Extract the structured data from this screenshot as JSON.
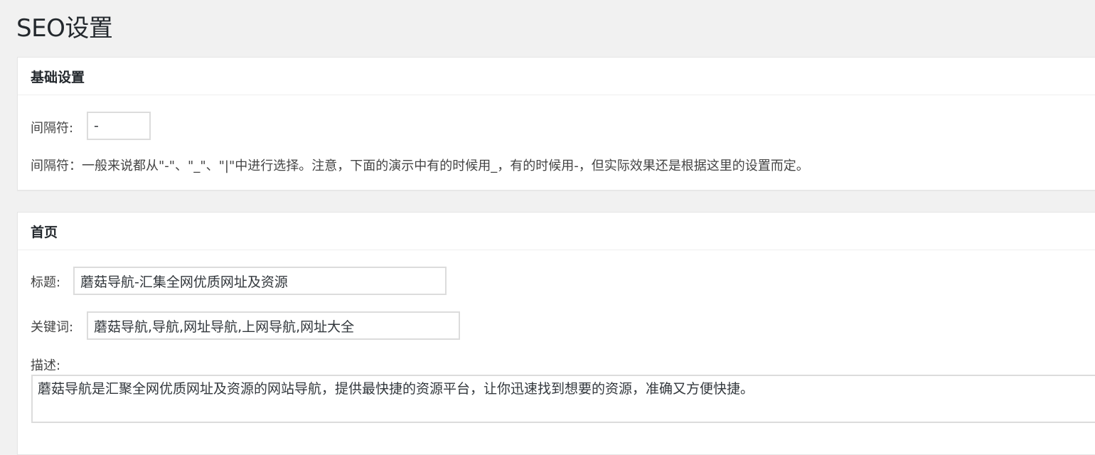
{
  "page": {
    "title": "SEO设置"
  },
  "basic": {
    "title": "基础设置",
    "separator_label": "间隔符:",
    "separator_value": "-",
    "separator_help": "间隔符：一般来说都从\"-\"、\"_\"、\"|\"中进行选择。注意，下面的演示中有的时候用_，有的时候用-，但实际效果还是根据这里的设置而定。"
  },
  "home": {
    "title": "首页",
    "title_label": "标题:",
    "title_value": "蘑菇导航-汇集全网优质网址及资源",
    "keywords_label": "关键词:",
    "keywords_value": "蘑菇导航,导航,网址导航,上网导航,网址大全",
    "description_label": "描述:",
    "description_value": "蘑菇导航是汇聚全网优质网址及资源的网站导航，提供最快捷的资源平台，让你迅速找到想要的资源，准确又方便快捷。"
  }
}
